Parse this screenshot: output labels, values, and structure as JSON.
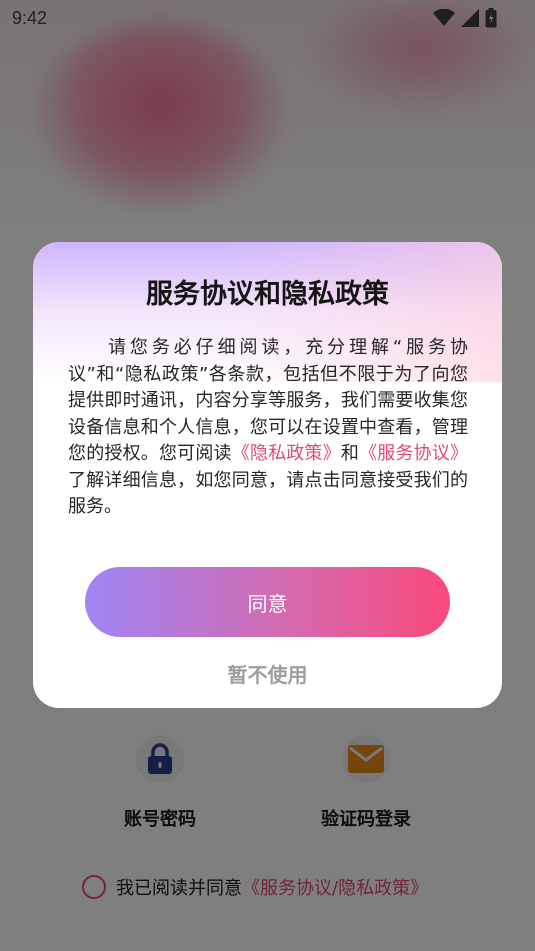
{
  "status_bar": {
    "time": "9:42",
    "icons": [
      "wifi-icon",
      "signal-icon",
      "battery-icon"
    ]
  },
  "login_options": {
    "password_label": "账号密码",
    "sms_label": "验证码登录"
  },
  "agreement_row": {
    "prefix": "我已阅读并同意",
    "link": "《服务协议/隐私政策》"
  },
  "dialog": {
    "title": "服务协议和隐私政策",
    "body_part1": "请您务必仔细阅读，充分理解“服务协议”和“隐私政策”各条款，包括但不限于为了向您提供即时通讯，内容分享等服务，我们需要收集您设备信息和个人信息，您可以在设置中查看，管理您的授权。您可阅读",
    "privacy_link": "《隐私政策》",
    "and_text": "和",
    "service_link": "《服务协议》",
    "body_part2": "了解详细信息，如您同意，请点击同意接受我们的服务。",
    "agree_button": "同意",
    "refuse_button": "暂不使用"
  },
  "colors": {
    "accent_pink": "#e34a70",
    "button_gradient_start": "#9d86f5",
    "button_gradient_end": "#f9497a",
    "lock_icon": "#2e3f8f",
    "mail_icon": "#e88c1a"
  }
}
